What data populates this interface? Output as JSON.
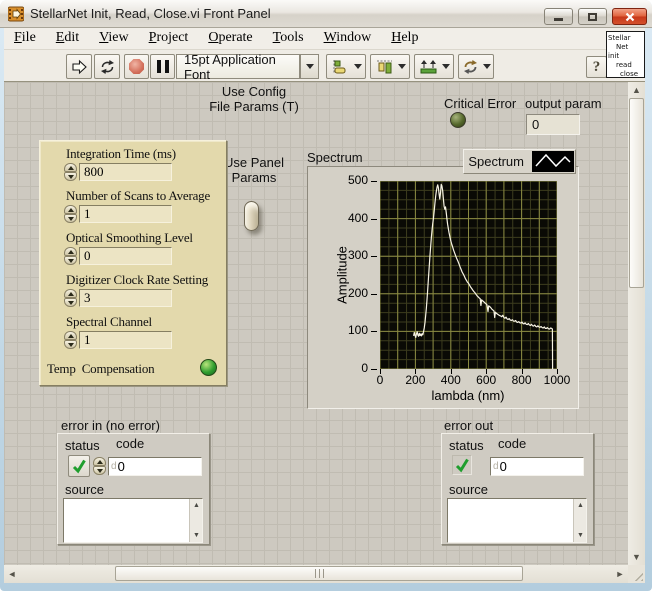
{
  "window": {
    "title": "StellarNet Init, Read, Close.vi Front Panel"
  },
  "menu": {
    "items": [
      "File",
      "Edit",
      "View",
      "Project",
      "Operate",
      "Tools",
      "Window",
      "Help"
    ]
  },
  "toolbar": {
    "font_selector": "15pt Application Font",
    "help_glyph": "?"
  },
  "vi_icon": {
    "lines": [
      "Stellar",
      "Net",
      "init",
      "read",
      "close"
    ]
  },
  "panel": {
    "config_toggle": {
      "top_label": "Use Config\nFile Params (T)",
      "bottom_label": "Use Panel\nParams"
    },
    "critical_error": {
      "label": "Critical Error"
    },
    "output_param": {
      "label": "output param",
      "value": "0"
    },
    "cluster": {
      "controls": [
        {
          "label": "Integration Time (ms)",
          "value": "800"
        },
        {
          "label": "Number of Scans to Average",
          "value": "1"
        },
        {
          "label": "Optical Smoothing Level",
          "value": "0"
        },
        {
          "label": "Digitizer Clock Rate Setting",
          "value": "3"
        },
        {
          "label": "Spectral Channel",
          "value": "1"
        }
      ],
      "led_label": "Temp  Compensation"
    },
    "graph": {
      "label": "Spectrum",
      "legend": "Spectrum"
    },
    "error_in": {
      "label": "error in (no error)",
      "status_label": "status",
      "code_label": "code",
      "code_radix": "d",
      "code_value": "0",
      "source_label": "source",
      "source_value": ""
    },
    "error_out": {
      "label": "error out",
      "status_label": "status",
      "code_label": "code",
      "code_radix": "d",
      "code_value": "0",
      "source_label": "source",
      "source_value": ""
    }
  },
  "colors": {
    "critical_error_led": "#55682c",
    "temp_compensation_led": "#2f9e2f",
    "status_check": "#1f9e2e",
    "panel_background": "#cdc9c0",
    "cluster_background": "#e3d9ac"
  },
  "chart_data": {
    "type": "line",
    "title": "Spectrum",
    "xlabel": "lambda (nm)",
    "ylabel": "Amplitude",
    "xlim": [
      0,
      1000
    ],
    "ylim": [
      0,
      500
    ],
    "x_ticks": [
      0,
      200,
      400,
      600,
      800,
      1000
    ],
    "y_ticks": [
      0,
      100,
      200,
      300,
      400,
      500
    ],
    "grid": {
      "major_step_x": 100,
      "minor_step_x": 50,
      "major_step_y": 100,
      "minor_step_y": 25,
      "major_color": "#8a8a42",
      "minor_color": "#3c3c1e"
    },
    "plot_bg": "#0a0a05",
    "legend_position": "top-right",
    "series": [
      {
        "name": "Spectrum",
        "color": "#f8f4e4",
        "points": [
          [
            190,
            88
          ],
          [
            194,
            97
          ],
          [
            198,
            90
          ],
          [
            202,
            84
          ],
          [
            206,
            94
          ],
          [
            210,
            99
          ],
          [
            214,
            90
          ],
          [
            218,
            87
          ],
          [
            222,
            95
          ],
          [
            226,
            89
          ],
          [
            230,
            93
          ],
          [
            234,
            88
          ],
          [
            238,
            94
          ],
          [
            242,
            91
          ],
          [
            246,
            99
          ],
          [
            250,
            110
          ],
          [
            254,
            124
          ],
          [
            258,
            143
          ],
          [
            262,
            163
          ],
          [
            266,
            188
          ],
          [
            270,
            215
          ],
          [
            274,
            243
          ],
          [
            278,
            271
          ],
          [
            282,
            299
          ],
          [
            286,
            324
          ],
          [
            290,
            348
          ],
          [
            294,
            368
          ],
          [
            298,
            386
          ],
          [
            302,
            402
          ],
          [
            306,
            420
          ],
          [
            310,
            440
          ],
          [
            314,
            458
          ],
          [
            318,
            472
          ],
          [
            322,
            483
          ],
          [
            326,
            490
          ],
          [
            330,
            482
          ],
          [
            334,
            465
          ],
          [
            338,
            452
          ],
          [
            342,
            468
          ],
          [
            346,
            491
          ],
          [
            350,
            487
          ],
          [
            354,
            474
          ],
          [
            358,
            452
          ],
          [
            362,
            433
          ],
          [
            366,
            425
          ],
          [
            370,
            431
          ],
          [
            374,
            417
          ],
          [
            378,
            400
          ],
          [
            382,
            385
          ],
          [
            386,
            374
          ],
          [
            390,
            363
          ],
          [
            394,
            354
          ],
          [
            398,
            345
          ],
          [
            404,
            334
          ],
          [
            410,
            325
          ],
          [
            416,
            316
          ],
          [
            422,
            308
          ],
          [
            428,
            300
          ],
          [
            434,
            293
          ],
          [
            440,
            287
          ],
          [
            446,
            280
          ],
          [
            452,
            272
          ],
          [
            458,
            265
          ],
          [
            464,
            258
          ],
          [
            470,
            253
          ],
          [
            476,
            247
          ],
          [
            482,
            241
          ],
          [
            488,
            236
          ],
          [
            494,
            231
          ],
          [
            500,
            228
          ],
          [
            506,
            223
          ],
          [
            512,
            218
          ],
          [
            518,
            214
          ],
          [
            524,
            210
          ],
          [
            530,
            206
          ],
          [
            536,
            203
          ],
          [
            542,
            199
          ],
          [
            548,
            195
          ],
          [
            554,
            192
          ],
          [
            560,
            189
          ],
          [
            566,
            187
          ],
          [
            570,
            169
          ],
          [
            574,
            184
          ],
          [
            580,
            181
          ],
          [
            586,
            179
          ],
          [
            592,
            176
          ],
          [
            598,
            174
          ],
          [
            604,
            171
          ],
          [
            610,
            153
          ],
          [
            614,
            168
          ],
          [
            620,
            166
          ],
          [
            626,
            163
          ],
          [
            632,
            159
          ],
          [
            638,
            157
          ],
          [
            644,
            154
          ],
          [
            648,
            137
          ],
          [
            652,
            151
          ],
          [
            658,
            148
          ],
          [
            664,
            146
          ],
          [
            670,
            144
          ],
          [
            676,
            142
          ],
          [
            682,
            141
          ],
          [
            688,
            139
          ],
          [
            694,
            143
          ],
          [
            700,
            137
          ],
          [
            706,
            135
          ],
          [
            712,
            138
          ],
          [
            718,
            133
          ],
          [
            724,
            132
          ],
          [
            730,
            134
          ],
          [
            736,
            130
          ],
          [
            742,
            129
          ],
          [
            748,
            131
          ],
          [
            754,
            127
          ],
          [
            760,
            127
          ],
          [
            766,
            129
          ],
          [
            772,
            125
          ],
          [
            778,
            124
          ],
          [
            784,
            126
          ],
          [
            790,
            123
          ],
          [
            796,
            122
          ],
          [
            802,
            125
          ],
          [
            808,
            121
          ],
          [
            814,
            120
          ],
          [
            820,
            123
          ],
          [
            826,
            119
          ],
          [
            832,
            118
          ],
          [
            838,
            121
          ],
          [
            844,
            117
          ],
          [
            850,
            116
          ],
          [
            856,
            119
          ],
          [
            862,
            115
          ],
          [
            868,
            114
          ],
          [
            874,
            117
          ],
          [
            880,
            113
          ],
          [
            886,
            112
          ],
          [
            892,
            115
          ],
          [
            898,
            112
          ],
          [
            904,
            111
          ],
          [
            910,
            113
          ],
          [
            916,
            110
          ],
          [
            922,
            109
          ],
          [
            928,
            112
          ],
          [
            934,
            108
          ],
          [
            940,
            108
          ],
          [
            946,
            110
          ],
          [
            952,
            107
          ],
          [
            958,
            106
          ],
          [
            964,
            109
          ],
          [
            970,
            108
          ],
          [
            974,
            106
          ],
          [
            975,
            0
          ]
        ]
      }
    ]
  }
}
